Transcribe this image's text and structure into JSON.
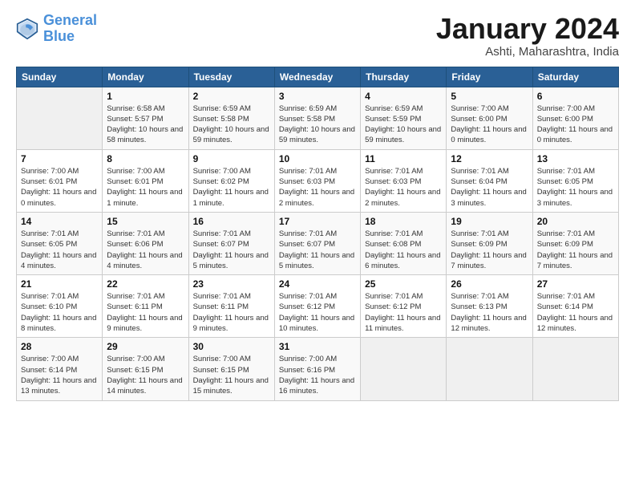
{
  "app": {
    "logo_line1": "General",
    "logo_line2": "Blue"
  },
  "header": {
    "month_year": "January 2024",
    "location": "Ashti, Maharashtra, India"
  },
  "weekdays": [
    "Sunday",
    "Monday",
    "Tuesday",
    "Wednesday",
    "Thursday",
    "Friday",
    "Saturday"
  ],
  "weeks": [
    [
      {
        "day": "",
        "sunrise": "",
        "sunset": "",
        "daylight": "",
        "empty": true
      },
      {
        "day": "1",
        "sunrise": "Sunrise: 6:58 AM",
        "sunset": "Sunset: 5:57 PM",
        "daylight": "Daylight: 10 hours and 58 minutes."
      },
      {
        "day": "2",
        "sunrise": "Sunrise: 6:59 AM",
        "sunset": "Sunset: 5:58 PM",
        "daylight": "Daylight: 10 hours and 59 minutes."
      },
      {
        "day": "3",
        "sunrise": "Sunrise: 6:59 AM",
        "sunset": "Sunset: 5:58 PM",
        "daylight": "Daylight: 10 hours and 59 minutes."
      },
      {
        "day": "4",
        "sunrise": "Sunrise: 6:59 AM",
        "sunset": "Sunset: 5:59 PM",
        "daylight": "Daylight: 10 hours and 59 minutes."
      },
      {
        "day": "5",
        "sunrise": "Sunrise: 7:00 AM",
        "sunset": "Sunset: 6:00 PM",
        "daylight": "Daylight: 11 hours and 0 minutes."
      },
      {
        "day": "6",
        "sunrise": "Sunrise: 7:00 AM",
        "sunset": "Sunset: 6:00 PM",
        "daylight": "Daylight: 11 hours and 0 minutes."
      }
    ],
    [
      {
        "day": "7",
        "sunrise": "Sunrise: 7:00 AM",
        "sunset": "Sunset: 6:01 PM",
        "daylight": "Daylight: 11 hours and 0 minutes."
      },
      {
        "day": "8",
        "sunrise": "Sunrise: 7:00 AM",
        "sunset": "Sunset: 6:01 PM",
        "daylight": "Daylight: 11 hours and 1 minute."
      },
      {
        "day": "9",
        "sunrise": "Sunrise: 7:00 AM",
        "sunset": "Sunset: 6:02 PM",
        "daylight": "Daylight: 11 hours and 1 minute."
      },
      {
        "day": "10",
        "sunrise": "Sunrise: 7:01 AM",
        "sunset": "Sunset: 6:03 PM",
        "daylight": "Daylight: 11 hours and 2 minutes."
      },
      {
        "day": "11",
        "sunrise": "Sunrise: 7:01 AM",
        "sunset": "Sunset: 6:03 PM",
        "daylight": "Daylight: 11 hours and 2 minutes."
      },
      {
        "day": "12",
        "sunrise": "Sunrise: 7:01 AM",
        "sunset": "Sunset: 6:04 PM",
        "daylight": "Daylight: 11 hours and 3 minutes."
      },
      {
        "day": "13",
        "sunrise": "Sunrise: 7:01 AM",
        "sunset": "Sunset: 6:05 PM",
        "daylight": "Daylight: 11 hours and 3 minutes."
      }
    ],
    [
      {
        "day": "14",
        "sunrise": "Sunrise: 7:01 AM",
        "sunset": "Sunset: 6:05 PM",
        "daylight": "Daylight: 11 hours and 4 minutes."
      },
      {
        "day": "15",
        "sunrise": "Sunrise: 7:01 AM",
        "sunset": "Sunset: 6:06 PM",
        "daylight": "Daylight: 11 hours and 4 minutes."
      },
      {
        "day": "16",
        "sunrise": "Sunrise: 7:01 AM",
        "sunset": "Sunset: 6:07 PM",
        "daylight": "Daylight: 11 hours and 5 minutes."
      },
      {
        "day": "17",
        "sunrise": "Sunrise: 7:01 AM",
        "sunset": "Sunset: 6:07 PM",
        "daylight": "Daylight: 11 hours and 5 minutes."
      },
      {
        "day": "18",
        "sunrise": "Sunrise: 7:01 AM",
        "sunset": "Sunset: 6:08 PM",
        "daylight": "Daylight: 11 hours and 6 minutes."
      },
      {
        "day": "19",
        "sunrise": "Sunrise: 7:01 AM",
        "sunset": "Sunset: 6:09 PM",
        "daylight": "Daylight: 11 hours and 7 minutes."
      },
      {
        "day": "20",
        "sunrise": "Sunrise: 7:01 AM",
        "sunset": "Sunset: 6:09 PM",
        "daylight": "Daylight: 11 hours and 7 minutes."
      }
    ],
    [
      {
        "day": "21",
        "sunrise": "Sunrise: 7:01 AM",
        "sunset": "Sunset: 6:10 PM",
        "daylight": "Daylight: 11 hours and 8 minutes."
      },
      {
        "day": "22",
        "sunrise": "Sunrise: 7:01 AM",
        "sunset": "Sunset: 6:11 PM",
        "daylight": "Daylight: 11 hours and 9 minutes."
      },
      {
        "day": "23",
        "sunrise": "Sunrise: 7:01 AM",
        "sunset": "Sunset: 6:11 PM",
        "daylight": "Daylight: 11 hours and 9 minutes."
      },
      {
        "day": "24",
        "sunrise": "Sunrise: 7:01 AM",
        "sunset": "Sunset: 6:12 PM",
        "daylight": "Daylight: 11 hours and 10 minutes."
      },
      {
        "day": "25",
        "sunrise": "Sunrise: 7:01 AM",
        "sunset": "Sunset: 6:12 PM",
        "daylight": "Daylight: 11 hours and 11 minutes."
      },
      {
        "day": "26",
        "sunrise": "Sunrise: 7:01 AM",
        "sunset": "Sunset: 6:13 PM",
        "daylight": "Daylight: 11 hours and 12 minutes."
      },
      {
        "day": "27",
        "sunrise": "Sunrise: 7:01 AM",
        "sunset": "Sunset: 6:14 PM",
        "daylight": "Daylight: 11 hours and 12 minutes."
      }
    ],
    [
      {
        "day": "28",
        "sunrise": "Sunrise: 7:00 AM",
        "sunset": "Sunset: 6:14 PM",
        "daylight": "Daylight: 11 hours and 13 minutes."
      },
      {
        "day": "29",
        "sunrise": "Sunrise: 7:00 AM",
        "sunset": "Sunset: 6:15 PM",
        "daylight": "Daylight: 11 hours and 14 minutes."
      },
      {
        "day": "30",
        "sunrise": "Sunrise: 7:00 AM",
        "sunset": "Sunset: 6:15 PM",
        "daylight": "Daylight: 11 hours and 15 minutes."
      },
      {
        "day": "31",
        "sunrise": "Sunrise: 7:00 AM",
        "sunset": "Sunset: 6:16 PM",
        "daylight": "Daylight: 11 hours and 16 minutes."
      },
      {
        "day": "",
        "sunrise": "",
        "sunset": "",
        "daylight": "",
        "empty": true
      },
      {
        "day": "",
        "sunrise": "",
        "sunset": "",
        "daylight": "",
        "empty": true
      },
      {
        "day": "",
        "sunrise": "",
        "sunset": "",
        "daylight": "",
        "empty": true
      }
    ]
  ]
}
